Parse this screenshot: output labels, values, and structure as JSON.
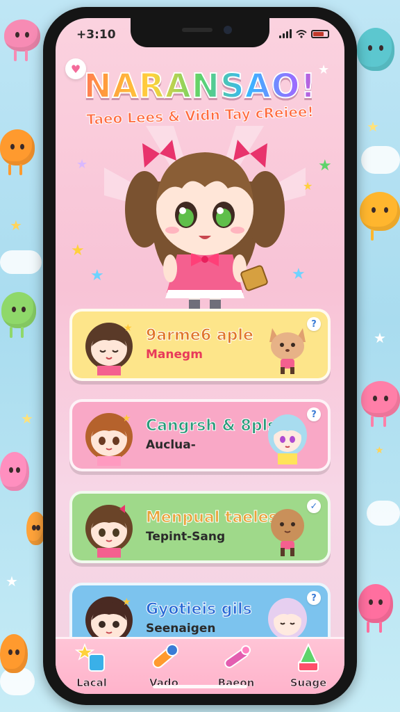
{
  "status_bar": {
    "time": "+3:10"
  },
  "header": {
    "title": "NARANSAO!",
    "subtitle": "Taeo Lees & Vidn Tay cReiee!"
  },
  "cards": [
    {
      "title": "9arme6 aple",
      "subtitle": "Manegm",
      "bg": "#fde58a",
      "title_color": "#e0772a",
      "sub_color": "#e83a5a"
    },
    {
      "title": "Cangrsh & 8pls",
      "subtitle": "Auclua-",
      "bg": "#f9a8c6",
      "title_color": "#2a9a7a",
      "sub_color": "#2a2a2a"
    },
    {
      "title": "Menpual taeles",
      "subtitle": "Tepint-Sang",
      "bg": "#9fd98a",
      "title_color": "#e8a33a",
      "sub_color": "#2a2a2a"
    },
    {
      "title": "Gyotieis gils",
      "subtitle": "Seenaigen",
      "bg": "#7cc3ee",
      "title_color": "#2a6ad5",
      "sub_color": "#2a2a2a"
    }
  ],
  "tabs": [
    {
      "label": "Lacal",
      "icon": "star-cup-icon"
    },
    {
      "label": "Vado",
      "icon": "pencil-icon"
    },
    {
      "label": "Baeon",
      "icon": "crayon-icon"
    },
    {
      "label": "Suage",
      "icon": "cone-icon"
    }
  ],
  "colors": {
    "accent": "#ff4f7f",
    "card_info": "#3a7bd5"
  }
}
